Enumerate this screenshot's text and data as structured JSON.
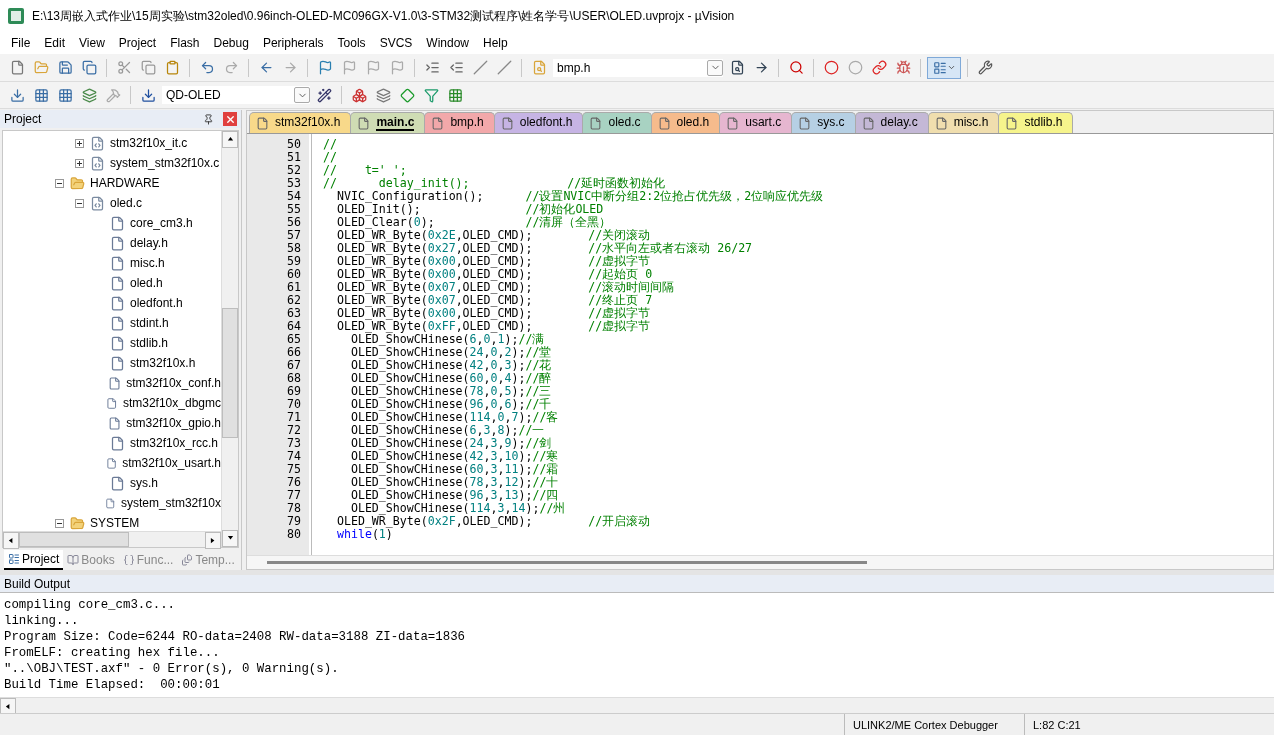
{
  "window": {
    "title": "E:\\13周嵌入式作业\\15周实验\\stm32oled\\0.96inch-OLED-MC096GX-V1.0\\3-STM32测试程序\\姓名学号\\USER\\OLED.uvprojx - µVision"
  },
  "menu": [
    "File",
    "Edit",
    "View",
    "Project",
    "Flash",
    "Debug",
    "Peripherals",
    "Tools",
    "SVCS",
    "Window",
    "Help"
  ],
  "toolbar": {
    "file_combo": {
      "value": "bmp.h"
    },
    "target_combo": {
      "value": "QD-OLED"
    }
  },
  "project_panel": {
    "title": "Project",
    "tree": [
      {
        "children": [
          {
            "label": "stm32f10x_it.c",
            "expanded": false
          },
          {
            "label": "system_stm32f10x.c",
            "expanded": false
          }
        ]
      },
      {
        "label": "HARDWARE",
        "expanded": true,
        "children": [
          {
            "label": "oled.c",
            "expanded": true,
            "children": [
              {
                "label": "core_cm3.h"
              },
              {
                "label": "delay.h"
              },
              {
                "label": "misc.h"
              },
              {
                "label": "oled.h"
              },
              {
                "label": "oledfont.h"
              },
              {
                "label": "stdint.h"
              },
              {
                "label": "stdlib.h"
              },
              {
                "label": "stm32f10x.h"
              },
              {
                "label": "stm32f10x_conf.h"
              },
              {
                "label": "stm32f10x_dbgmc"
              },
              {
                "label": "stm32f10x_gpio.h"
              },
              {
                "label": "stm32f10x_rcc.h"
              },
              {
                "label": "stm32f10x_usart.h"
              },
              {
                "label": "sys.h"
              },
              {
                "label": "system_stm32f10x"
              }
            ]
          }
        ]
      },
      {
        "label": "SYSTEM",
        "expanded": true
      }
    ],
    "tabs": [
      {
        "label": "Project",
        "selected": true
      },
      {
        "label": "Books",
        "selected": false
      },
      {
        "label": "Func...",
        "selected": false
      },
      {
        "label": "Temp...",
        "selected": false
      }
    ]
  },
  "editor": {
    "tabs": [
      {
        "label": "stm32f10x.h",
        "color": "#f8d98a",
        "selected": false
      },
      {
        "label": "main.c",
        "color": "#cfdcb4",
        "selected": true
      },
      {
        "label": "bmp.h",
        "color": "#f2a8aa",
        "selected": false
      },
      {
        "label": "oledfont.h",
        "color": "#c6b4e4",
        "selected": false
      },
      {
        "label": "oled.c",
        "color": "#a8d2c2",
        "selected": false
      },
      {
        "label": "oled.h",
        "color": "#f6bb8c",
        "selected": false
      },
      {
        "label": "usart.c",
        "color": "#e6b6d0",
        "selected": false
      },
      {
        "label": "sys.c",
        "color": "#b6d0e4",
        "selected": false
      },
      {
        "label": "delay.c",
        "color": "#c4b8d6",
        "selected": false
      },
      {
        "label": "misc.h",
        "color": "#f0deae",
        "selected": false
      },
      {
        "label": "stdlib.h",
        "color": "#f6f48c",
        "selected": false
      }
    ],
    "lines": [
      {
        "number": "50",
        "segments": [
          {
            "kind": "comment",
            "text": "//"
          }
        ]
      },
      {
        "number": "51",
        "segments": [
          {
            "kind": "comment",
            "text": "//"
          }
        ]
      },
      {
        "number": "52",
        "segments": [
          {
            "kind": "comment",
            "text": "//    t=' ';"
          }
        ]
      },
      {
        "number": "53",
        "segments": [
          {
            "kind": "comment",
            "text": "//      delay_init();              //延时函数初始化"
          }
        ]
      },
      {
        "number": "54",
        "segments": [
          {
            "kind": "plain",
            "text": "  NVIC_Configuration();      "
          },
          {
            "kind": "comment",
            "text": "//设置NVIC中断分组2:2位抢占优先级，2位响应优先级"
          }
        ]
      },
      {
        "number": "55",
        "segments": [
          {
            "kind": "plain",
            "text": "  OLED_Init();               "
          },
          {
            "kind": "comment",
            "text": "//初始化OLED"
          }
        ]
      },
      {
        "number": "56",
        "segments": [
          {
            "kind": "plain",
            "text": "  OLED_Clear("
          },
          {
            "kind": "number",
            "text": "0"
          },
          {
            "kind": "plain",
            "text": ");             "
          },
          {
            "kind": "comment",
            "text": "//清屏（全黑）"
          }
        ]
      },
      {
        "number": "57",
        "segments": [
          {
            "kind": "plain",
            "text": "  OLED_WR_Byte("
          },
          {
            "kind": "number",
            "text": "0x2E"
          },
          {
            "kind": "plain",
            "text": ",OLED_CMD);        "
          },
          {
            "kind": "comment",
            "text": "//关闭滚动"
          }
        ]
      },
      {
        "number": "58",
        "segments": [
          {
            "kind": "plain",
            "text": "  OLED_WR_Byte("
          },
          {
            "kind": "number",
            "text": "0x27"
          },
          {
            "kind": "plain",
            "text": ",OLED_CMD);        "
          },
          {
            "kind": "comment",
            "text": "//水平向左或者右滚动 26/27"
          }
        ]
      },
      {
        "number": "59",
        "segments": [
          {
            "kind": "plain",
            "text": "  OLED_WR_Byte("
          },
          {
            "kind": "number",
            "text": "0x00"
          },
          {
            "kind": "plain",
            "text": ",OLED_CMD);        "
          },
          {
            "kind": "comment",
            "text": "//虚拟字节"
          }
        ]
      },
      {
        "number": "60",
        "segments": [
          {
            "kind": "plain",
            "text": "  OLED_WR_Byte("
          },
          {
            "kind": "number",
            "text": "0x00"
          },
          {
            "kind": "plain",
            "text": ",OLED_CMD);        "
          },
          {
            "kind": "comment",
            "text": "//起始页 0"
          }
        ]
      },
      {
        "number": "61",
        "segments": [
          {
            "kind": "plain",
            "text": "  OLED_WR_Byte("
          },
          {
            "kind": "number",
            "text": "0x07"
          },
          {
            "kind": "plain",
            "text": ",OLED_CMD);        "
          },
          {
            "kind": "comment",
            "text": "//滚动时间间隔"
          }
        ]
      },
      {
        "number": "62",
        "segments": [
          {
            "kind": "plain",
            "text": "  OLED_WR_Byte("
          },
          {
            "kind": "number",
            "text": "0x07"
          },
          {
            "kind": "plain",
            "text": ",OLED_CMD);        "
          },
          {
            "kind": "comment",
            "text": "//终止页 7"
          }
        ]
      },
      {
        "number": "63",
        "segments": [
          {
            "kind": "plain",
            "text": "  OLED_WR_Byte("
          },
          {
            "kind": "number",
            "text": "0x00"
          },
          {
            "kind": "plain",
            "text": ",OLED_CMD);        "
          },
          {
            "kind": "comment",
            "text": "//虚拟字节"
          }
        ]
      },
      {
        "number": "64",
        "segments": [
          {
            "kind": "plain",
            "text": "  OLED_WR_Byte("
          },
          {
            "kind": "number",
            "text": "0xFF"
          },
          {
            "kind": "plain",
            "text": ",OLED_CMD);        "
          },
          {
            "kind": "comment",
            "text": "//虚拟字节"
          }
        ]
      },
      {
        "number": "65",
        "segments": [
          {
            "kind": "plain",
            "text": "    OLED_ShowCHinese("
          },
          {
            "kind": "number",
            "text": "6"
          },
          {
            "kind": "plain",
            "text": ","
          },
          {
            "kind": "number",
            "text": "0"
          },
          {
            "kind": "plain",
            "text": ","
          },
          {
            "kind": "number",
            "text": "1"
          },
          {
            "kind": "plain",
            "text": ");"
          },
          {
            "kind": "comment",
            "text": "//满"
          }
        ]
      },
      {
        "number": "66",
        "segments": [
          {
            "kind": "plain",
            "text": "    OLED_ShowCHinese("
          },
          {
            "kind": "number",
            "text": "24"
          },
          {
            "kind": "plain",
            "text": ","
          },
          {
            "kind": "number",
            "text": "0"
          },
          {
            "kind": "plain",
            "text": ","
          },
          {
            "kind": "number",
            "text": "2"
          },
          {
            "kind": "plain",
            "text": ");"
          },
          {
            "kind": "comment",
            "text": "//堂"
          }
        ]
      },
      {
        "number": "67",
        "segments": [
          {
            "kind": "plain",
            "text": "    OLED_ShowCHinese("
          },
          {
            "kind": "number",
            "text": "42"
          },
          {
            "kind": "plain",
            "text": ","
          },
          {
            "kind": "number",
            "text": "0"
          },
          {
            "kind": "plain",
            "text": ","
          },
          {
            "kind": "number",
            "text": "3"
          },
          {
            "kind": "plain",
            "text": ");"
          },
          {
            "kind": "comment",
            "text": "//花"
          }
        ]
      },
      {
        "number": "68",
        "segments": [
          {
            "kind": "plain",
            "text": "    OLED_ShowCHinese("
          },
          {
            "kind": "number",
            "text": "60"
          },
          {
            "kind": "plain",
            "text": ","
          },
          {
            "kind": "number",
            "text": "0"
          },
          {
            "kind": "plain",
            "text": ","
          },
          {
            "kind": "number",
            "text": "4"
          },
          {
            "kind": "plain",
            "text": ");"
          },
          {
            "kind": "comment",
            "text": "//醉"
          }
        ]
      },
      {
        "number": "69",
        "segments": [
          {
            "kind": "plain",
            "text": "    OLED_ShowCHinese("
          },
          {
            "kind": "number",
            "text": "78"
          },
          {
            "kind": "plain",
            "text": ","
          },
          {
            "kind": "number",
            "text": "0"
          },
          {
            "kind": "plain",
            "text": ","
          },
          {
            "kind": "number",
            "text": "5"
          },
          {
            "kind": "plain",
            "text": ");"
          },
          {
            "kind": "comment",
            "text": "//三"
          }
        ]
      },
      {
        "number": "70",
        "segments": [
          {
            "kind": "plain",
            "text": "    OLED_ShowCHinese("
          },
          {
            "kind": "number",
            "text": "96"
          },
          {
            "kind": "plain",
            "text": ","
          },
          {
            "kind": "number",
            "text": "0"
          },
          {
            "kind": "plain",
            "text": ","
          },
          {
            "kind": "number",
            "text": "6"
          },
          {
            "kind": "plain",
            "text": ");"
          },
          {
            "kind": "comment",
            "text": "//千"
          }
        ]
      },
      {
        "number": "71",
        "segments": [
          {
            "kind": "plain",
            "text": "    OLED_ShowCHinese("
          },
          {
            "kind": "number",
            "text": "114"
          },
          {
            "kind": "plain",
            "text": ","
          },
          {
            "kind": "number",
            "text": "0"
          },
          {
            "kind": "plain",
            "text": ","
          },
          {
            "kind": "number",
            "text": "7"
          },
          {
            "kind": "plain",
            "text": ");"
          },
          {
            "kind": "comment",
            "text": "//客"
          }
        ]
      },
      {
        "number": "72",
        "segments": [
          {
            "kind": "plain",
            "text": "    OLED_ShowCHinese("
          },
          {
            "kind": "number",
            "text": "6"
          },
          {
            "kind": "plain",
            "text": ","
          },
          {
            "kind": "number",
            "text": "3"
          },
          {
            "kind": "plain",
            "text": ","
          },
          {
            "kind": "number",
            "text": "8"
          },
          {
            "kind": "plain",
            "text": ");"
          },
          {
            "kind": "comment",
            "text": "//一"
          }
        ]
      },
      {
        "number": "73",
        "segments": [
          {
            "kind": "plain",
            "text": "    OLED_ShowCHinese("
          },
          {
            "kind": "number",
            "text": "24"
          },
          {
            "kind": "plain",
            "text": ","
          },
          {
            "kind": "number",
            "text": "3"
          },
          {
            "kind": "plain",
            "text": ","
          },
          {
            "kind": "number",
            "text": "9"
          },
          {
            "kind": "plain",
            "text": ");"
          },
          {
            "kind": "comment",
            "text": "//剑"
          }
        ]
      },
      {
        "number": "74",
        "segments": [
          {
            "kind": "plain",
            "text": "    OLED_ShowCHinese("
          },
          {
            "kind": "number",
            "text": "42"
          },
          {
            "kind": "plain",
            "text": ","
          },
          {
            "kind": "number",
            "text": "3"
          },
          {
            "kind": "plain",
            "text": ","
          },
          {
            "kind": "number",
            "text": "10"
          },
          {
            "kind": "plain",
            "text": ");"
          },
          {
            "kind": "comment",
            "text": "//寒"
          }
        ]
      },
      {
        "number": "75",
        "segments": [
          {
            "kind": "plain",
            "text": "    OLED_ShowCHinese("
          },
          {
            "kind": "number",
            "text": "60"
          },
          {
            "kind": "plain",
            "text": ","
          },
          {
            "kind": "number",
            "text": "3"
          },
          {
            "kind": "plain",
            "text": ","
          },
          {
            "kind": "number",
            "text": "11"
          },
          {
            "kind": "plain",
            "text": ");"
          },
          {
            "kind": "comment",
            "text": "//霜"
          }
        ]
      },
      {
        "number": "76",
        "segments": [
          {
            "kind": "plain",
            "text": "    OLED_ShowCHinese("
          },
          {
            "kind": "number",
            "text": "78"
          },
          {
            "kind": "plain",
            "text": ","
          },
          {
            "kind": "number",
            "text": "3"
          },
          {
            "kind": "plain",
            "text": ","
          },
          {
            "kind": "number",
            "text": "12"
          },
          {
            "kind": "plain",
            "text": ");"
          },
          {
            "kind": "comment",
            "text": "//十"
          }
        ]
      },
      {
        "number": "77",
        "segments": [
          {
            "kind": "plain",
            "text": "    OLED_ShowCHinese("
          },
          {
            "kind": "number",
            "text": "96"
          },
          {
            "kind": "plain",
            "text": ","
          },
          {
            "kind": "number",
            "text": "3"
          },
          {
            "kind": "plain",
            "text": ","
          },
          {
            "kind": "number",
            "text": "13"
          },
          {
            "kind": "plain",
            "text": ");"
          },
          {
            "kind": "comment",
            "text": "//四"
          }
        ]
      },
      {
        "number": "78",
        "segments": [
          {
            "kind": "plain",
            "text": "    OLED_ShowCHinese("
          },
          {
            "kind": "number",
            "text": "114"
          },
          {
            "kind": "plain",
            "text": ","
          },
          {
            "kind": "number",
            "text": "3"
          },
          {
            "kind": "plain",
            "text": ","
          },
          {
            "kind": "number",
            "text": "14"
          },
          {
            "kind": "plain",
            "text": ");"
          },
          {
            "kind": "comment",
            "text": "//州"
          }
        ]
      },
      {
        "number": "79",
        "segments": [
          {
            "kind": "plain",
            "text": "  OLED_WR_Byte("
          },
          {
            "kind": "number",
            "text": "0x2F"
          },
          {
            "kind": "plain",
            "text": ",OLED_CMD);        "
          },
          {
            "kind": "comment",
            "text": "//开启滚动"
          }
        ]
      },
      {
        "number": "80",
        "segments": [
          {
            "kind": "keyword",
            "text": "  while"
          },
          {
            "kind": "plain",
            "text": "("
          },
          {
            "kind": "number",
            "text": "1"
          },
          {
            "kind": "plain",
            "text": ")"
          }
        ]
      }
    ]
  },
  "build_output": {
    "title": "Build Output",
    "lines": [
      "compiling core_cm3.c...",
      "linking...",
      "Program Size: Code=6244 RO-data=2408 RW-data=3188 ZI-data=1836",
      "FromELF: creating hex file...",
      "\"..\\OBJ\\TEST.axf\" - 0 Error(s), 0 Warning(s).",
      "Build Time Elapsed:  00:00:01"
    ]
  },
  "status_bar": {
    "debugger": "ULINK2/ME Cortex Debugger",
    "position": "L:82 C:21"
  }
}
